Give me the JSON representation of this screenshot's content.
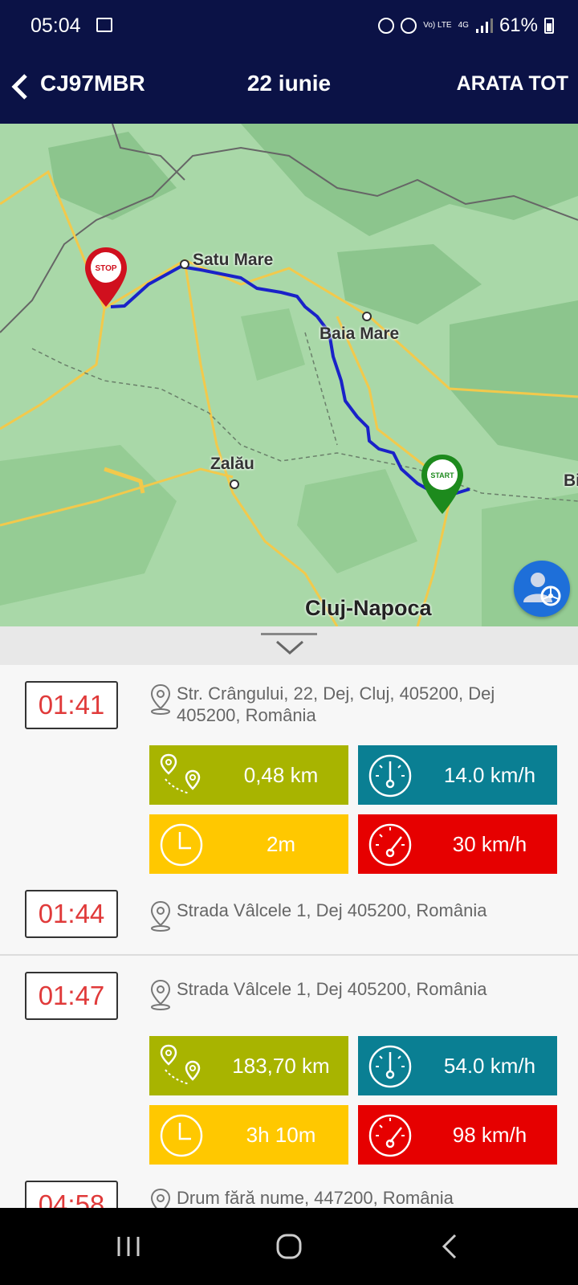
{
  "status_bar": {
    "time": "05:04",
    "network": "4G",
    "volte": "Vo) LTE",
    "battery": "61%"
  },
  "header": {
    "plate": "CJ97MBR",
    "date": "22 iunie",
    "show_all": "ARATA TOT"
  },
  "map": {
    "labels": {
      "satu_mare": "Satu Mare",
      "baia_mare": "Baia Mare",
      "zalau": "Zalău",
      "cluj": "Cluj-Napoca",
      "bi": "Bi"
    },
    "stop_marker": "STOP",
    "start_marker": "START",
    "route_color": "#1a22c8"
  },
  "stops": [
    {
      "time": "01:41",
      "address": "Str. Crângului, 22, Dej, Cluj, 405200, Dej 405200, România",
      "distance": "0,48 km",
      "avg_speed": "14.0 km/h",
      "duration": "2m",
      "max_speed": "30 km/h"
    },
    {
      "time": "01:44",
      "address": "Strada Vâlcele 1, Dej 405200, România"
    },
    {
      "time": "01:47",
      "address": "Strada Vâlcele 1, Dej 405200, România",
      "distance": "183,70 km",
      "avg_speed": "54.0 km/h",
      "duration": "3h 10m",
      "max_speed": "98 km/h"
    },
    {
      "time": "04:58",
      "address": "Drum fără nume, 447200, România"
    }
  ],
  "colors": {
    "header_bg": "#0b1246",
    "distance_tile": "#a8b400",
    "avg_speed_tile": "#0a7f93",
    "duration_tile": "#ffc800",
    "max_speed_tile": "#e60000",
    "time_text": "#e03a3a"
  }
}
